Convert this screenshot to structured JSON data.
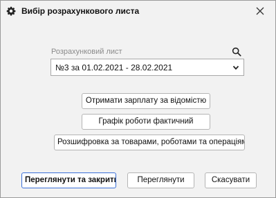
{
  "window": {
    "title": "Вибір розрахункового листа",
    "icon": "gear-icon"
  },
  "field": {
    "label": "Розрахунковий лист",
    "selected_value": "№3 за 01.02.2021 - 28.02.2021"
  },
  "actions": {
    "get_salary": "Отримати зарплату за відомістю",
    "work_schedule": "Графік роботи фактичний",
    "breakdown": "Розшифровка за товарами, роботами та операціями"
  },
  "footer": {
    "view_and_close": "Переглянути та закрити",
    "view": "Переглянути",
    "cancel": "Скасувати"
  },
  "colors": {
    "accent_border": "#3a6fd8"
  }
}
